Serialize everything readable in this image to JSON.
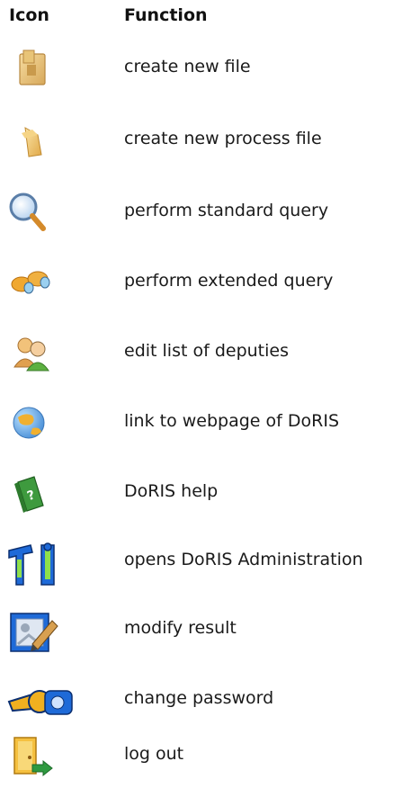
{
  "header": {
    "icon_label": "Icon",
    "function_label": "Function"
  },
  "rows": [
    {
      "icon": "new-file-icon",
      "label": "create new file"
    },
    {
      "icon": "new-process-file-icon",
      "label": "create new process file"
    },
    {
      "icon": "magnifier-icon",
      "label": "perform standard query"
    },
    {
      "icon": "binoculars-icon",
      "label": "perform extended query"
    },
    {
      "icon": "deputies-icon",
      "label": "edit list of deputies"
    },
    {
      "icon": "globe-icon",
      "label": "link to webpage of DoRIS"
    },
    {
      "icon": "help-book-icon",
      "label": "DoRIS help"
    },
    {
      "icon": "admin-tools-icon",
      "label": "opens DoRIS Administration"
    },
    {
      "icon": "modify-result-icon",
      "label": "modify result"
    },
    {
      "icon": "key-icon",
      "label": "change password"
    },
    {
      "icon": "logout-door-icon",
      "label": "log out"
    }
  ]
}
